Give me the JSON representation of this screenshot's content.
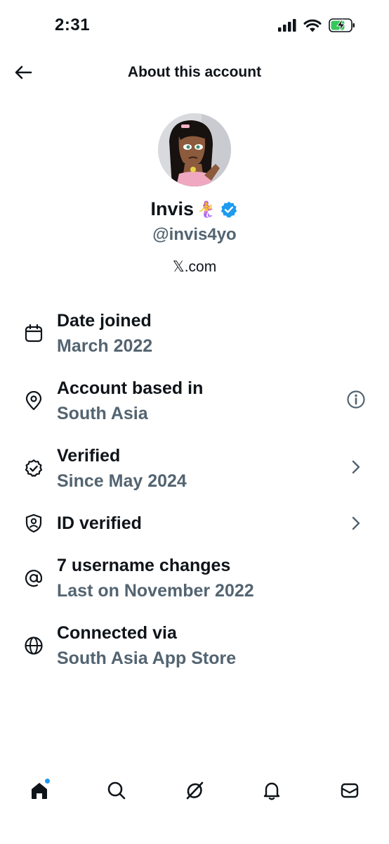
{
  "status_bar": {
    "time": "2:31",
    "icons": [
      "cellular-signal-icon",
      "wifi-icon",
      "battery-charging-icon"
    ],
    "battery_color": "#34c759"
  },
  "header": {
    "title": "About this account",
    "back_icon": "arrow-left-icon"
  },
  "profile": {
    "display_name": "Invis",
    "name_emoji": "🧜‍♀️",
    "verified_badge": "verified-badge-icon",
    "handle": "@invis4yo",
    "domain": "𝕏.com"
  },
  "info_items": [
    {
      "icon": "calendar-icon",
      "title": "Date joined",
      "value": "March 2022",
      "action": ""
    },
    {
      "icon": "location-pin-icon",
      "title": "Account based in",
      "value": "South Asia",
      "action": "info-icon"
    },
    {
      "icon": "verified-check-icon",
      "title": "Verified",
      "value": "Since May 2024",
      "action": "chevron-right-icon"
    },
    {
      "icon": "id-shield-icon",
      "title": "ID verified",
      "value": "",
      "action": "chevron-right-icon"
    },
    {
      "icon": "at-sign-icon",
      "title": "7 username changes",
      "value": "Last on November 2022",
      "action": ""
    },
    {
      "icon": "globe-icon",
      "title": "Connected via",
      "value": "South Asia App Store",
      "action": ""
    }
  ],
  "bottom_nav": {
    "items": [
      "home-icon",
      "search-icon",
      "grok-icon",
      "notifications-icon",
      "messages-icon"
    ],
    "active": "home-icon",
    "unread_dot_color": "#1d9bf0"
  },
  "colors": {
    "primary_text": "#0f1419",
    "secondary_text": "#536471",
    "accent": "#1d9bf0"
  }
}
